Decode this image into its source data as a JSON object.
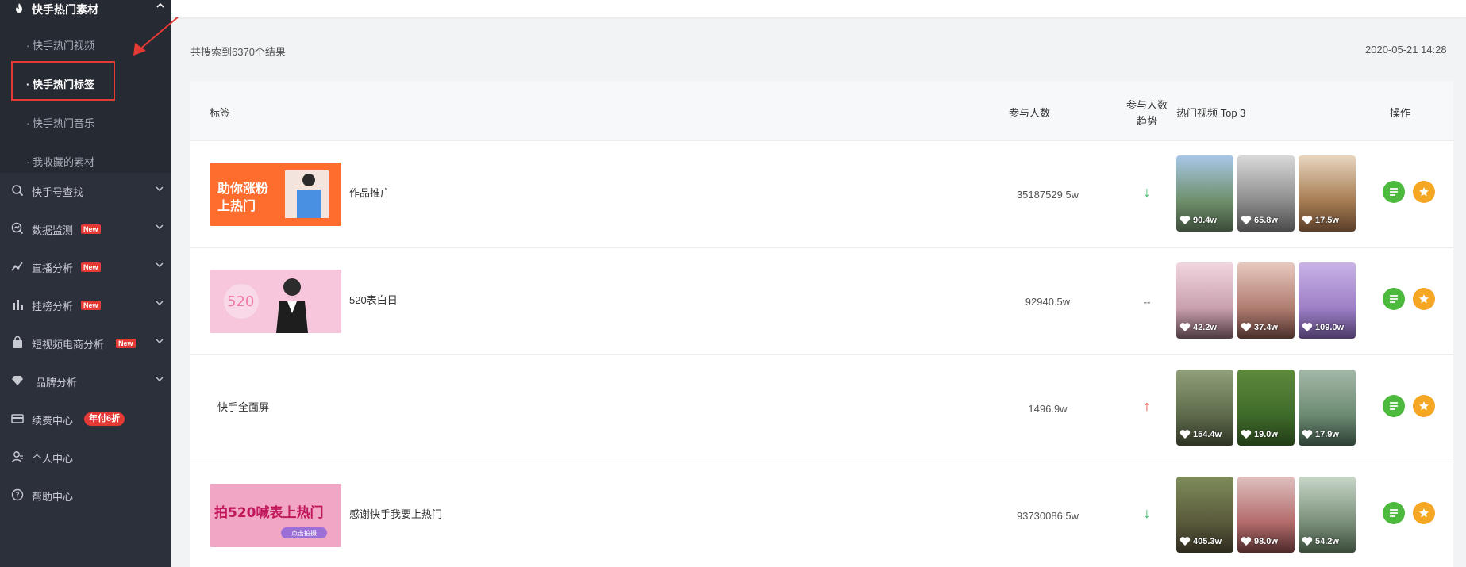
{
  "sidebar": {
    "section_title": "快手热门素材",
    "sub_items": [
      {
        "label": "· 快手热门视频"
      },
      {
        "label": "· 快手热门标签"
      },
      {
        "label": "· 快手热门音乐"
      },
      {
        "label": "· 我收藏的素材"
      }
    ],
    "items": [
      {
        "label": "快手号查找",
        "icon": "search-icon"
      },
      {
        "label": "数据监测",
        "icon": "monitor-icon",
        "badge": "New"
      },
      {
        "label": "直播分析",
        "icon": "line-chart-icon",
        "badge": "New"
      },
      {
        "label": "挂榜分析",
        "icon": "bar-chart-icon",
        "badge": "New"
      },
      {
        "label": "短视频电商分析",
        "icon": "shopping-bag-icon",
        "badge": "New"
      },
      {
        "label": "品牌分析",
        "icon": "diamond-icon"
      },
      {
        "label": "续费中心",
        "icon": "card-icon",
        "promo": "年付6折"
      },
      {
        "label": "个人中心",
        "icon": "user-icon"
      },
      {
        "label": "帮助中心",
        "icon": "help-icon"
      }
    ]
  },
  "main": {
    "result_count": "共搜索到6370个结果",
    "timestamp": "2020-05-21 14:28",
    "headers": {
      "tag": "标签",
      "participants": "参与人数",
      "trend_line1": "参与人数",
      "trend_line2": "趋势",
      "top_videos": "热门视频 Top 3",
      "actions": "操作"
    },
    "rows": [
      {
        "tag": "作品推广",
        "thumb_text_line1": "助你涨粉",
        "thumb_text_line2": "上热门",
        "participants": "35187529.5w",
        "trend": "down",
        "trend_symbol": "↓",
        "videos": [
          {
            "likes": "90.4w"
          },
          {
            "likes": "65.8w"
          },
          {
            "likes": "17.5w"
          }
        ]
      },
      {
        "tag": "520表白日",
        "thumb_text_line1": "520",
        "participants": "92940.5w",
        "trend": "flat",
        "trend_symbol": "--",
        "videos": [
          {
            "likes": "42.2w"
          },
          {
            "likes": "37.4w"
          },
          {
            "likes": "109.0w"
          }
        ]
      },
      {
        "tag": "快手全面屏",
        "participants": "1496.9w",
        "trend": "up",
        "trend_symbol": "↑",
        "videos": [
          {
            "likes": "154.4w"
          },
          {
            "likes": "19.0w"
          },
          {
            "likes": "17.9w"
          }
        ]
      },
      {
        "tag": "感谢快手我要上热门",
        "thumb_text_line1": "拍520喊表上热门",
        "thumb_text_line2": "点击拍摄",
        "participants": "93730086.5w",
        "trend": "down",
        "trend_symbol": "↓",
        "videos": [
          {
            "likes": "405.3w"
          },
          {
            "likes": "98.0w"
          },
          {
            "likes": "54.2w"
          }
        ]
      }
    ]
  },
  "colors": {
    "sidebar_bg": "#2c303b",
    "accent_red": "#e53935",
    "trend_down": "#2db55d",
    "trend_up": "#e53935",
    "action_green": "#4cba3c",
    "action_orange": "#f5a623"
  }
}
